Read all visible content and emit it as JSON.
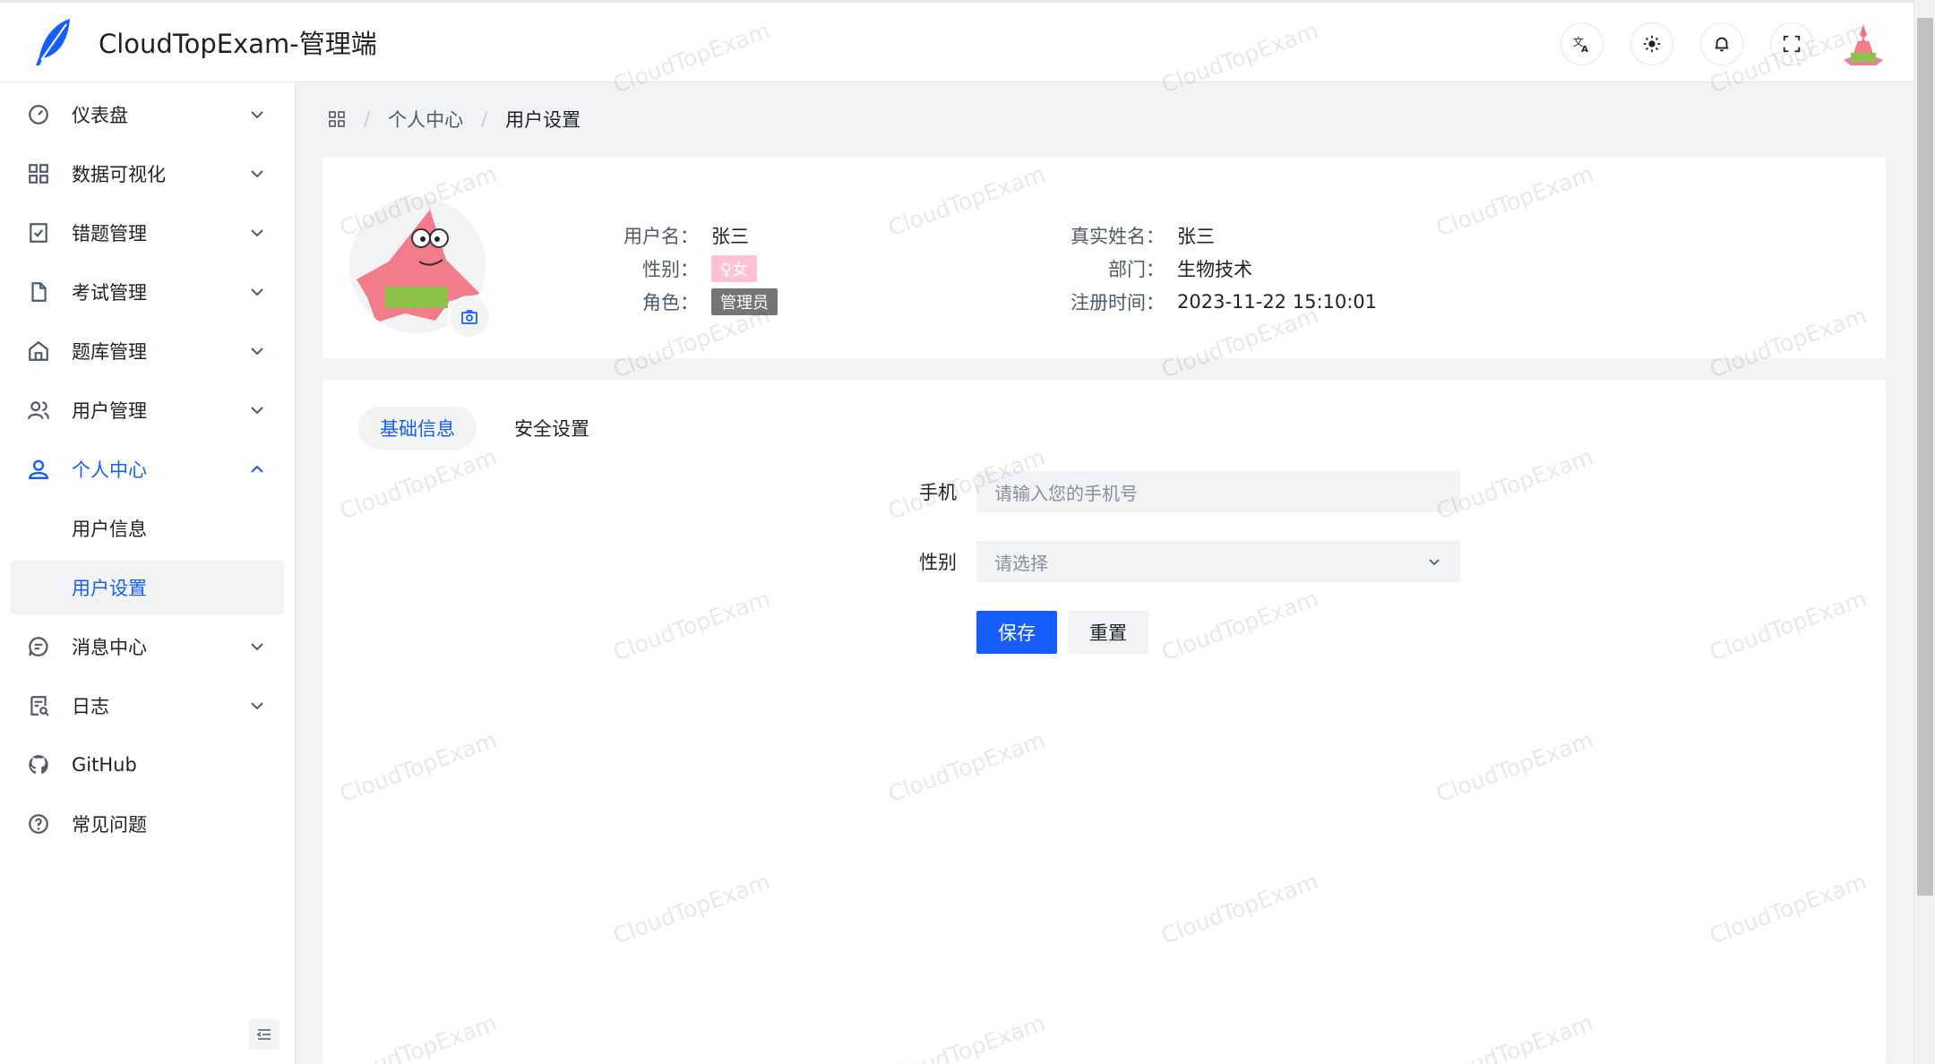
{
  "app": {
    "title": "CloudTopExam-管理端"
  },
  "header": {
    "icons": [
      "translate-icon",
      "theme-icon",
      "bell-icon",
      "fullscreen-icon"
    ]
  },
  "sidebar": {
    "items": [
      {
        "label": "仪表盘",
        "icon": "dashboard-icon",
        "chevron": "down"
      },
      {
        "label": "数据可视化",
        "icon": "grid-icon",
        "chevron": "down"
      },
      {
        "label": "错题管理",
        "icon": "checklist-icon",
        "chevron": "down"
      },
      {
        "label": "考试管理",
        "icon": "file-icon",
        "chevron": "down"
      },
      {
        "label": "题库管理",
        "icon": "bank-icon",
        "chevron": "down"
      },
      {
        "label": "用户管理",
        "icon": "users-icon",
        "chevron": "down"
      },
      {
        "label": "个人中心",
        "icon": "user-icon",
        "chevron": "up"
      },
      {
        "label": "消息中心",
        "icon": "message-icon",
        "chevron": "down"
      },
      {
        "label": "日志",
        "icon": "log-icon",
        "chevron": "down"
      },
      {
        "label": "GitHub",
        "icon": "github-icon"
      },
      {
        "label": "常见问题",
        "icon": "question-icon"
      }
    ],
    "sub_items": [
      "用户信息",
      "用户设置"
    ]
  },
  "breadcrumb": {
    "items": [
      "个人中心",
      "用户设置"
    ]
  },
  "profile": {
    "username_label": "用户名：",
    "username": "张三",
    "gender_label": "性别：",
    "gender": "♀女",
    "role_label": "角色：",
    "role": "管理员",
    "realname_label": "真实姓名：",
    "realname": "张三",
    "dept_label": "部门：",
    "dept": "生物技术",
    "reg_label": "注册时间：",
    "reg_time": "2023-11-22 15:10:01"
  },
  "tabs": [
    "基础信息",
    "安全设置"
  ],
  "form": {
    "phone_label": "手机",
    "phone_placeholder": "请输入您的手机号",
    "gender_label": "性别",
    "gender_placeholder": "请选择",
    "save": "保存",
    "reset": "重置"
  },
  "watermark": "CloudTopExam",
  "colors": {
    "primary": "#165dff",
    "female_tag": "#ffc1d3",
    "admin_tag": "#757575"
  }
}
